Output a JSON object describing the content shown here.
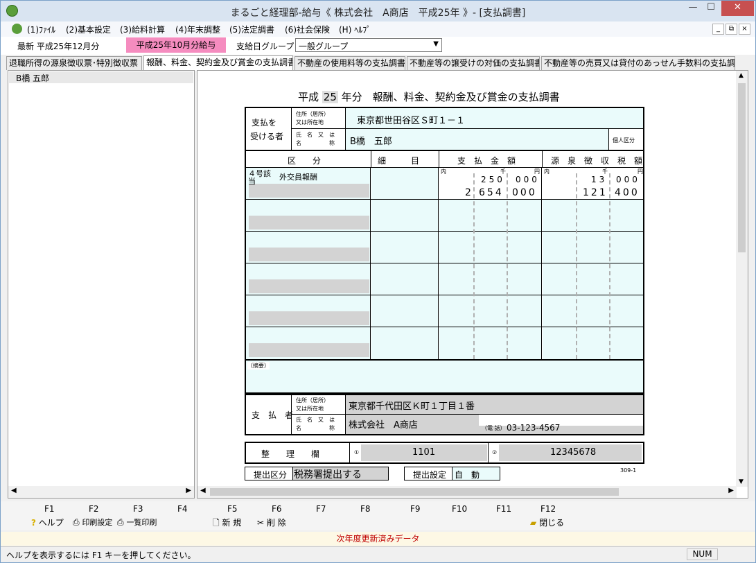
{
  "window": {
    "title": "まるごと経理部-給与《 株式会社　A商店　平成25年 》- [支払調書]",
    "minimize": "—",
    "maximize": "☐",
    "close": "✕"
  },
  "menu": [
    {
      "label": "(1)ﾌｧｲﾙ"
    },
    {
      "label": "(2)基本設定"
    },
    {
      "label": "(3)給料計算"
    },
    {
      "label": "(4)年末調整"
    },
    {
      "label": "(5)法定調書"
    },
    {
      "label": "(6)社会保険"
    },
    {
      "label": "(H) ﾍﾙﾌﾟ"
    }
  ],
  "mdi": {
    "minimize": "_",
    "restore": "⧉",
    "close": "×"
  },
  "infobar": {
    "latest": "最新  平成25年12月分",
    "payroll_badge": "平成25年10月分給与",
    "group_label": "支給日グループ",
    "group_value": "一般グループ"
  },
  "tabs": [
    {
      "label": "退職所得の源泉徴収票･特別徴収票"
    },
    {
      "label": "報酬、料金、契約金及び賞金の支払調書"
    },
    {
      "label": "不動産の使用料等の支払調書"
    },
    {
      "label": "不動産等の譲受けの対価の支払調書"
    },
    {
      "label": "不動産等の売買又は貸付のあっせん手数料の支払調書"
    }
  ],
  "list": {
    "items": [
      {
        "name": "B橋  五郎"
      }
    ]
  },
  "form": {
    "title_prefix": "平成",
    "year": "25",
    "title_suffix": "年分　報酬、料金、契約金及び賞金の支払調書",
    "recipient_label_1": "支払を",
    "recipient_label_2": "受ける者",
    "address_label_1": "住所（居所）",
    "address_label_2": "又は所在地",
    "address_value": "東京都世田谷区Ｓ町１－１",
    "name_label_1": "氏　名　又　は",
    "name_label_2": "名　　　　　称",
    "name_value": "B橋　五郎",
    "individual_label": "個人区分",
    "col_kubun": "区　　分",
    "col_detail": "細　　　目",
    "col_amount": "支　払　金　額",
    "col_tax": "源　泉　徴　収　税　額",
    "unit_uchi": "内",
    "unit_sen": "千",
    "unit_en": "円",
    "row1": {
      "kubun_1": "４号該",
      "kubun_2": "当",
      "detail": "外交員報酬",
      "amount_inner_thousands": "250",
      "amount_inner_yen": "000",
      "amount_millions": "2",
      "amount_thousands": "654",
      "amount_yen": "000",
      "tax_inner_thousands": "13",
      "tax_inner_yen": "000",
      "tax_thousands": "121",
      "tax_yen": "400"
    },
    "summary_label": "（摘要）",
    "payer_label": "支　払　者",
    "payer_address": "東京都千代田区Ｋ町１丁目１番",
    "payer_name": "株式会社　A商店",
    "phone_label": "（電 話）",
    "phone_value": "03-123-4567",
    "ref_label": "整　　理　　欄",
    "ref_mark_1": "①",
    "ref_value_1": "1101",
    "ref_mark_2": "②",
    "ref_value_2": "12345678",
    "form_code": "309-1",
    "submit_kubun_label": "提出区分",
    "submit_kubun_value": "税務署提出する",
    "submit_setting_label": "提出設定",
    "submit_setting_value": "自　動"
  },
  "fkeys": {
    "labels": [
      "F1",
      "F2",
      "F3",
      "F4",
      "F5",
      "F6",
      "F7",
      "F8",
      "F9",
      "F10",
      "F11",
      "F12"
    ],
    "help": "ヘルプ",
    "print_setting": "印刷設定",
    "list_print": "一覧印刷",
    "new": "新 規",
    "delete": "削 除",
    "close": "閉じる"
  },
  "status_message": "次年度更新済みデータ",
  "statusbar": {
    "help_text": "ヘルプを表示するには F1 キーを押してください。",
    "num": "NUM"
  },
  "colors": {
    "accent_pink": "#f58cbf",
    "field_cyan": "#eafbfb",
    "status_red": "#c00000"
  }
}
